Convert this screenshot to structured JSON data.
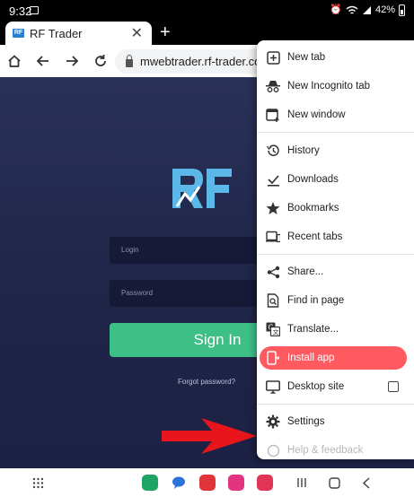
{
  "status_bar": {
    "time": "9:32",
    "battery": "42%"
  },
  "tab": {
    "title": "RF Trader",
    "favicon_text": "RF"
  },
  "toolbar": {
    "url": "mwebtrader.rf-trader.com/"
  },
  "page": {
    "logo_text": "RF",
    "login_placeholder": "Login",
    "password_placeholder": "Password",
    "signin_label": "Sign In",
    "forgot_label": "Forgot password?"
  },
  "menu": {
    "items": [
      {
        "label": "New tab",
        "icon": "plus-box-icon"
      },
      {
        "label": "New Incognito tab",
        "icon": "incognito-icon"
      },
      {
        "label": "New window",
        "icon": "new-window-icon"
      },
      {
        "label": "History",
        "icon": "history-icon"
      },
      {
        "label": "Downloads",
        "icon": "download-icon"
      },
      {
        "label": "Bookmarks",
        "icon": "star-icon"
      },
      {
        "label": "Recent tabs",
        "icon": "devices-icon"
      },
      {
        "label": "Share...",
        "icon": "share-icon"
      },
      {
        "label": "Find in page",
        "icon": "find-icon"
      },
      {
        "label": "Translate...",
        "icon": "translate-icon"
      },
      {
        "label": "Install app",
        "icon": "install-app-icon"
      },
      {
        "label": "Desktop site",
        "icon": "monitor-icon"
      },
      {
        "label": "Settings",
        "icon": "gear-icon"
      },
      {
        "label": "Help & feedback",
        "icon": "help-icon"
      }
    ],
    "desktop_site_checked": false
  },
  "colors": {
    "accent_green": "#3dbf86",
    "highlight_red": "#ff5a5f",
    "logo_blue": "#5bb8e8",
    "page_bg": "#232a52"
  }
}
